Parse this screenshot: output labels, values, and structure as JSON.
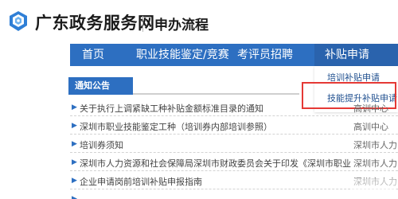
{
  "header": {
    "site_title": "广东政务服务网",
    "page_name": "申办流程"
  },
  "nav": {
    "items": [
      "首页",
      "职业技能鉴定/竞赛",
      "考评员招聘",
      "补贴申请"
    ]
  },
  "dropdown": {
    "items": [
      "培训补贴申请",
      "技能提升补贴申请"
    ],
    "highlighted_item": "技能提升补贴申请"
  },
  "notices": {
    "tab_label": "通知公告",
    "items": [
      {
        "title": "关于执行上调紧缺工种补贴金额标准目录的通知",
        "source": "高训中心"
      },
      {
        "title": "深圳市职业技能鉴定工种（培训券内部培训参照）",
        "source": "高训中心"
      },
      {
        "title": "培训券须知",
        "source": "深圳市人力"
      },
      {
        "title": "深圳市人力资源和社会保障局深圳市财政委员会关于印发《深圳市职业",
        "source": "深圳市人力"
      },
      {
        "title": "企业申请岗前培训补贴申报指南",
        "source": "深圳市人力"
      },
      {
        "title": "",
        "source": ""
      }
    ]
  },
  "colors": {
    "nav_blue": "#2d6fc1",
    "highlight_red": "#e53935",
    "logo_blue": "#2f7fd6"
  },
  "icons": {
    "logo": "guangdong-gov-logo-icon",
    "bullet": "triangle-bullet-icon"
  }
}
